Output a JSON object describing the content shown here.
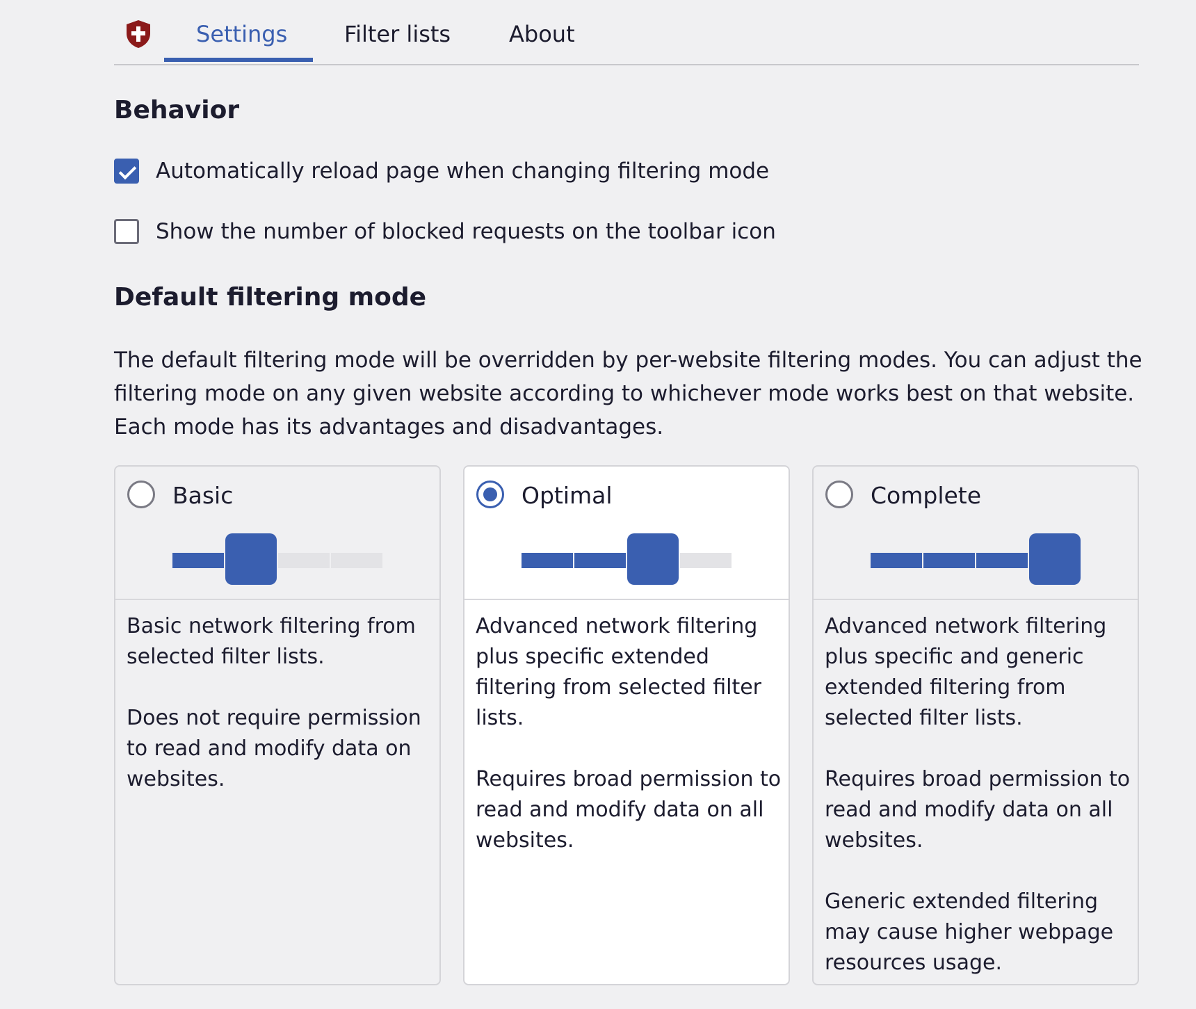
{
  "tabs": {
    "items": [
      {
        "label": "Settings",
        "active": true
      },
      {
        "label": "Filter lists",
        "active": false
      },
      {
        "label": "About",
        "active": false
      }
    ]
  },
  "behavior": {
    "heading": "Behavior",
    "options": [
      {
        "label": "Automatically reload page when changing filtering mode",
        "checked": true
      },
      {
        "label": "Show the number of blocked requests on the toolbar icon",
        "checked": false
      }
    ]
  },
  "filtering": {
    "heading": "Default filtering mode",
    "description": "The default filtering mode will be overridden by per-website filtering modes. You can adjust the filtering mode on any given website according to whichever mode works best on that website. Each mode has its advantages and disadvantages.",
    "modes": [
      {
        "title": "Basic",
        "selected": false,
        "level": 1,
        "max_level": 3,
        "paragraphs": [
          "Basic network filtering from selected filter lists.",
          "Does not require permission to read and modify data on websites."
        ]
      },
      {
        "title": "Optimal",
        "selected": true,
        "level": 2,
        "max_level": 3,
        "paragraphs": [
          "Advanced network filtering plus specific extended filtering from selected filter lists.",
          "Requires broad permission to read and modify data on all websites."
        ]
      },
      {
        "title": "Complete",
        "selected": false,
        "level": 3,
        "max_level": 3,
        "paragraphs": [
          "Advanced network filtering plus specific and generic extended filtering from selected filter lists.",
          "Requires broad permission to read and modify data on all websites.",
          "Generic extended filtering may cause higher webpage resources usage."
        ]
      }
    ]
  },
  "colors": {
    "accent": "#3a5fb0",
    "logo": "#8b1a1a",
    "background": "#f0f0f2"
  },
  "icons": {
    "logo": "shield-icon",
    "checkbox_checked": "checkmark-icon"
  }
}
